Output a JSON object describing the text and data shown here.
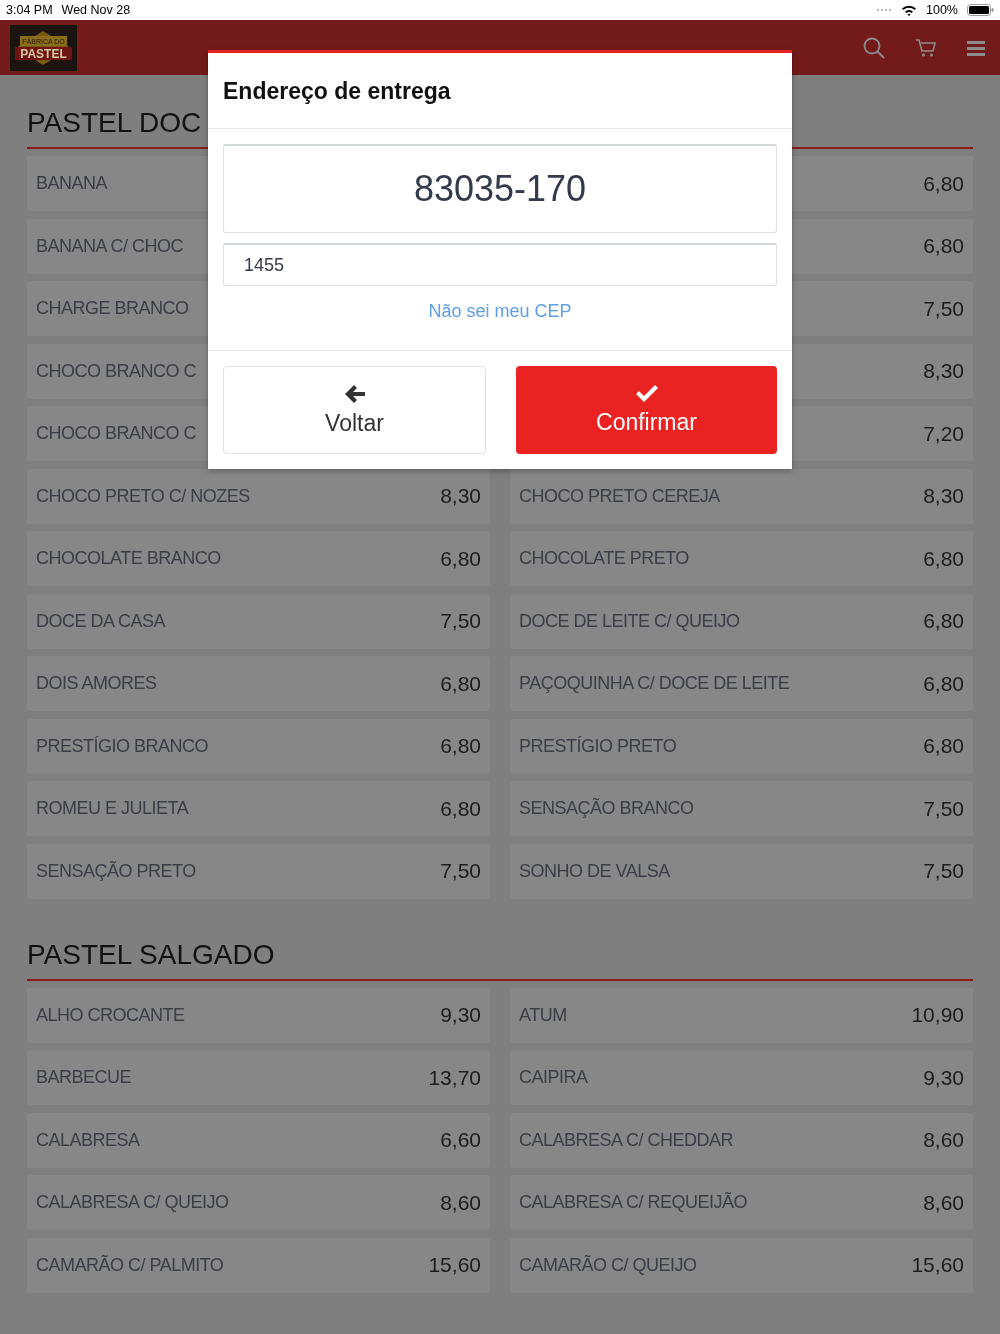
{
  "status_bar": {
    "time": "3:04 PM",
    "date": "Wed Nov 28",
    "battery": "100%"
  },
  "header": {
    "logo": {
      "line1": "FÁBRICA DO",
      "line2": "PASTEL"
    }
  },
  "sections": [
    {
      "title": "PASTEL DOC",
      "items": [
        {
          "name": "BANANA"
        },
        {
          "price": "6,80"
        },
        {
          "name": "BANANA C/ CHOC"
        },
        {
          "price": "6,80"
        },
        {
          "name": "CHARGE BRANCO"
        },
        {
          "price": "7,50"
        },
        {
          "name": "CHOCO BRANCO C"
        },
        {
          "price": "8,30"
        },
        {
          "name": "CHOCO BRANCO C"
        },
        {
          "price": "7,20"
        },
        {
          "name": "CHOCO PRETO C/ NOZES",
          "price": "8,30"
        },
        {
          "name": "CHOCO PRETO CEREJA",
          "price": "8,30"
        },
        {
          "name": "CHOCOLATE BRANCO",
          "price": "6,80"
        },
        {
          "name": "CHOCOLATE PRETO",
          "price": "6,80"
        },
        {
          "name": "DOCE DA CASA",
          "price": "7,50"
        },
        {
          "name": "DOCE DE LEITE C/ QUEIJO",
          "price": "6,80"
        },
        {
          "name": "DOIS AMORES",
          "price": "6,80"
        },
        {
          "name": "PAÇOQUINHA C/ DOCE DE LEITE",
          "price": "6,80"
        },
        {
          "name": "PRESTÍGIO BRANCO",
          "price": "6,80"
        },
        {
          "name": "PRESTÍGIO PRETO",
          "price": "6,80"
        },
        {
          "name": "ROMEU E JULIETA",
          "price": "6,80"
        },
        {
          "name": "SENSAÇÃO BRANCO",
          "price": "7,50"
        },
        {
          "name": "SENSAÇÃO PRETO",
          "price": "7,50"
        },
        {
          "name": "SONHO DE VALSA",
          "price": "7,50"
        }
      ]
    },
    {
      "title": "PASTEL SALGADO",
      "items": [
        {
          "name": "ALHO CROCANTE",
          "price": "9,30"
        },
        {
          "name": "ATUM",
          "price": "10,90"
        },
        {
          "name": "BARBECUE",
          "price": "13,70"
        },
        {
          "name": "CAIPIRA",
          "price": "9,30"
        },
        {
          "name": "CALABRESA",
          "price": "6,60"
        },
        {
          "name": "CALABRESA C/ CHEDDAR",
          "price": "8,60"
        },
        {
          "name": "CALABRESA C/ QUEIJO",
          "price": "8,60"
        },
        {
          "name": "CALABRESA C/ REQUEIJÃO",
          "price": "8,60"
        },
        {
          "name": "CAMARÃO C/ PALMITO",
          "price": "15,60"
        },
        {
          "name": "CAMARÃO C/ QUEIJO",
          "price": "15,60"
        }
      ]
    }
  ],
  "dialog": {
    "title": "Endereço de entrega",
    "cep_value": "83035-170",
    "number_value": "1455",
    "link": "Não sei meu CEP",
    "buttons": [
      {
        "kind": "back",
        "label": "Voltar"
      },
      {
        "kind": "confirm",
        "label": "Confirmar"
      }
    ]
  }
}
